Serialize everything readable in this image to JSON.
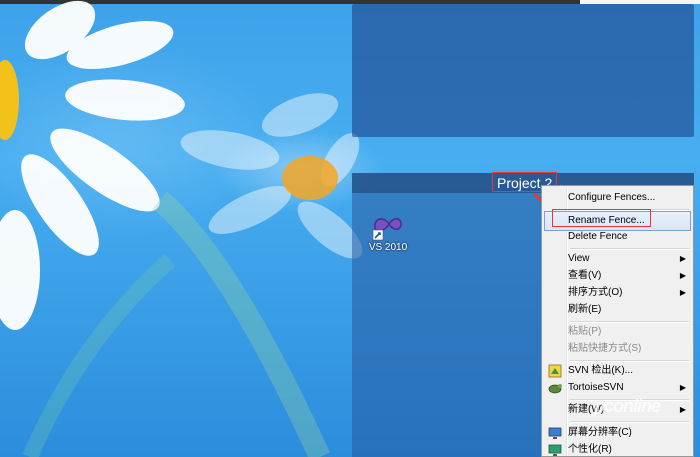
{
  "fence": {
    "title": "Project 2"
  },
  "shortcut": {
    "label": "VS 2010",
    "icon": "visual-studio-icon"
  },
  "context_menu": {
    "items": [
      {
        "label": "Configure Fences..."
      },
      {
        "label": "Rename Fence..."
      },
      {
        "label": "Delete Fence"
      },
      {
        "label": "View"
      },
      {
        "label": "查看(V)"
      },
      {
        "label": "排序方式(O)"
      },
      {
        "label": "刷新(E)"
      },
      {
        "label": "粘贴(P)"
      },
      {
        "label": "粘贴快捷方式(S)"
      },
      {
        "label": "SVN 检出(K)..."
      },
      {
        "label": "TortoiseSVN"
      },
      {
        "label": "新建(W)"
      },
      {
        "label": "屏幕分辨率(C)"
      },
      {
        "label": "个性化(R)"
      }
    ]
  },
  "watermark": "pconline",
  "colors": {
    "accent": "#e33333",
    "menu_highlight": "#d7e6f7",
    "desktop": "#47aef0"
  }
}
